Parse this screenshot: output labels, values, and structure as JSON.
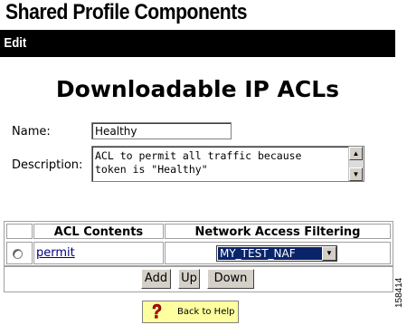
{
  "header": {
    "title": "Shared Profile Components",
    "bar_label": "Edit"
  },
  "page_title": "Downloadable IP ACLs",
  "form": {
    "name_label": "Name:",
    "name_value": "Healthy",
    "description_label": "Description:",
    "description_line1": "ACL to permit all traffic because",
    "description_line2": "token is \"Healthy\""
  },
  "table": {
    "headers": [
      "ACL Contents",
      "Network Access Filtering"
    ],
    "rows": [
      {
        "acl": "permit",
        "naf": "MY_TEST_NAF"
      }
    ]
  },
  "buttons": {
    "add": "Add",
    "up": "Up",
    "down": "Down"
  },
  "help": {
    "label": "Back to Help",
    "icon": "question-mark-icon"
  },
  "figure_number": "158414",
  "colors": {
    "bar": "#000000",
    "selection": "#0a246a",
    "link": "#000080",
    "help_bg": "#ffffa0"
  }
}
